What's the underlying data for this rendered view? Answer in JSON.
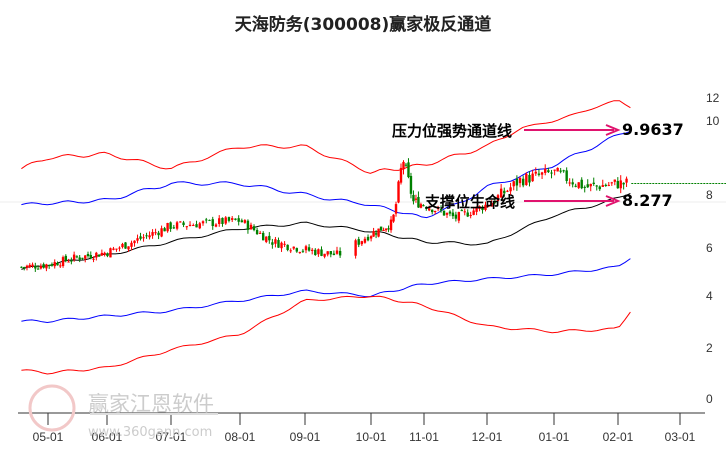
{
  "chart_data": {
    "type": "candlestick-channel",
    "title": "天海防务(300008)赢家极反通道",
    "x_ticks": [
      "05-01",
      "06-01",
      "07-01",
      "08-01",
      "09-01",
      "10-01",
      "11-01",
      "12-01",
      "01-01",
      "02-01",
      "03-01"
    ],
    "y_ticks": [
      "12",
      "10",
      "8",
      "6",
      "4",
      "2",
      "0"
    ],
    "y_tick_values": [
      12,
      10,
      8,
      6,
      4,
      2,
      0
    ],
    "band_t": [
      -0.45,
      0,
      1,
      2,
      3,
      4,
      5,
      6,
      7,
      8,
      9,
      9.2
    ],
    "series": [
      {
        "name": "upper-red",
        "color": "#ff0000",
        "values": [
          8.9,
          9.2,
          9.3,
          8.9,
          9.5,
          9.5,
          8.8,
          9.0,
          9.5,
          10.5,
          12.0,
          11.5
        ]
      },
      {
        "name": "upper-blue",
        "color": "#0000ff",
        "values": [
          7.9,
          7.95,
          8.05,
          8.5,
          8.5,
          8.2,
          7.9,
          7.4,
          8.4,
          9.0,
          9.8,
          9.96
        ]
      },
      {
        "name": "middle-black",
        "color": "#000000",
        "values": [
          5.4,
          5.6,
          6.0,
          6.5,
          7.0,
          7.2,
          6.9,
          6.5,
          6.4,
          7.5,
          8.1,
          8.28
        ]
      },
      {
        "name": "lower-blue",
        "color": "#0000ff",
        "values": [
          3.3,
          3.3,
          3.5,
          3.7,
          4.1,
          4.5,
          4.3,
          4.8,
          5.0,
          5.2,
          5.5,
          5.9
        ]
      },
      {
        "name": "lower-red",
        "color": "#ff0000",
        "values": [
          1.4,
          1.3,
          1.5,
          2.2,
          2.8,
          4.1,
          4.3,
          3.9,
          3.1,
          2.9,
          3.0,
          3.7
        ]
      }
    ],
    "close_t": [
      -0.45,
      0,
      0.5,
      1,
      1.5,
      2,
      2.5,
      3,
      3.5,
      4,
      4.5,
      5,
      5.4,
      5.6,
      5.8,
      6,
      6.5,
      7,
      7.5,
      8,
      8.5,
      9,
      9.15
    ],
    "close_values": [
      5.5,
      5.6,
      5.9,
      6.1,
      6.6,
      7.1,
      7.2,
      7.3,
      6.5,
      6.2,
      6.0,
      6.8,
      7.2,
      9.2,
      8.0,
      7.9,
      7.4,
      7.9,
      8.6,
      8.8,
      8.4,
      8.5,
      8.5
    ],
    "current_price": 8.5,
    "annotations": [
      {
        "label": "压力位强势通道线",
        "value": "9.9637"
      },
      {
        "label": "支撑位生命线",
        "value": "8.277"
      }
    ]
  },
  "watermark": {
    "name": "赢家江恩软件",
    "url": "www.360gann.com",
    "logo": "江赢恩家"
  }
}
